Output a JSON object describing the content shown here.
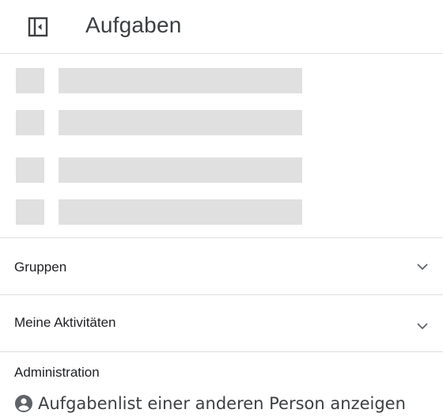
{
  "header": {
    "title": "Aufgaben",
    "collapse_icon": "sidebar-collapse-icon"
  },
  "skeleton": {
    "rows": 4,
    "color": "#e0e0e0"
  },
  "sections": [
    {
      "label": "Gruppen",
      "icon": "chevron-down-icon",
      "expanded": false
    },
    {
      "label": "Meine Aktivitäten",
      "icon": "chevron-down-icon",
      "expanded": false
    }
  ],
  "admin": {
    "title": "Administration",
    "link_label": "Aufgabenlist einer anderen Person anzeigen",
    "link_icon": "account-circle-icon"
  },
  "colors": {
    "divider": "#e0e0e0",
    "text": "#202124",
    "icon": "#5f6368"
  }
}
